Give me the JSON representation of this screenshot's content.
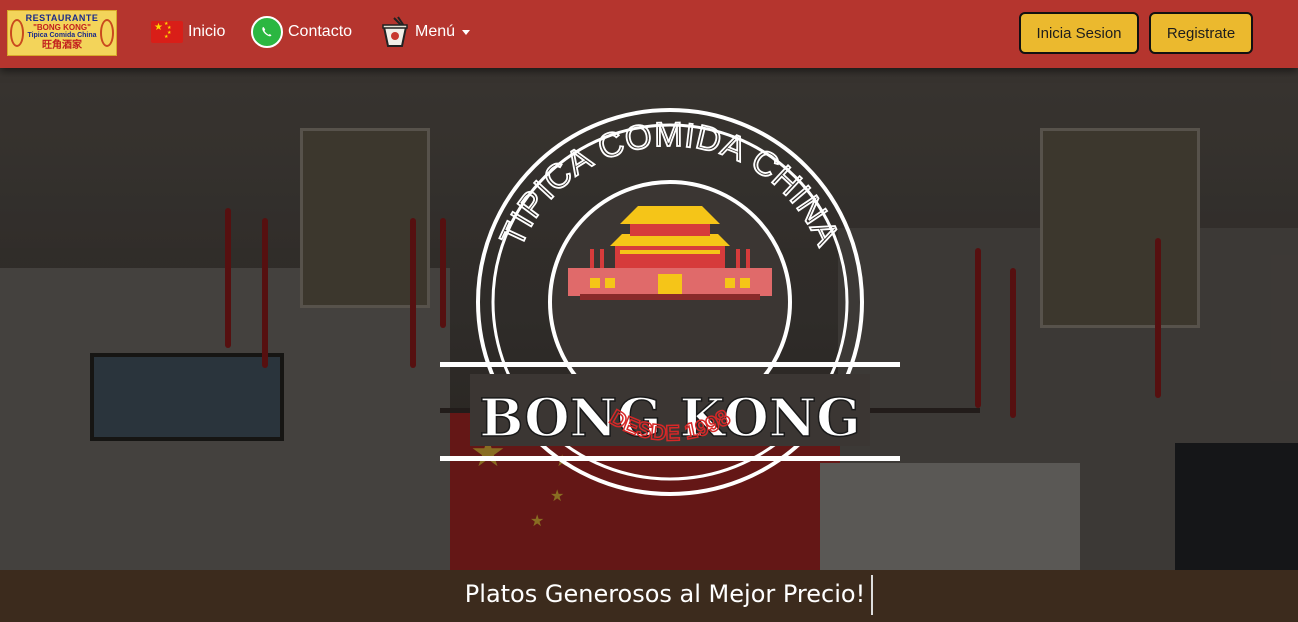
{
  "navbar": {
    "logo": {
      "line1": "RESTAURANTE",
      "line2": "\"BONG KONG\"",
      "line3": "Tipica Comida China",
      "line4": "旺角酒家"
    },
    "links": [
      {
        "label": "Inicio",
        "icon": "china-flag-icon"
      },
      {
        "label": "Contacto",
        "icon": "whatsapp-icon"
      },
      {
        "label": "Menú",
        "icon": "noodle-box-icon"
      }
    ],
    "buttons": {
      "login_label": "Inicia Sesion",
      "register_label": "Registrate"
    }
  },
  "hero": {
    "emblem": {
      "arc_text": "TIPICA COMIDA CHINA",
      "name": "BONG KONG",
      "since": "DESDE 1998"
    },
    "tagline": "Platos Generosos al Mejor Precio!"
  },
  "colors": {
    "navbar": "#b5352e",
    "button": "#ebb92e",
    "accent_red": "#d62828",
    "temple_yellow": "#f5c518"
  }
}
